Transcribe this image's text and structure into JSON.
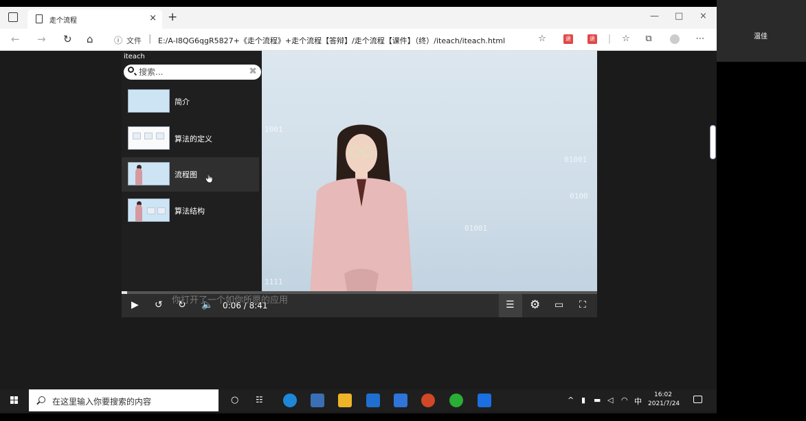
{
  "browser": {
    "tab_title": "走个流程",
    "tab_close": "×",
    "new_tab": "+",
    "window_controls": [
      "—",
      "□",
      "×"
    ],
    "url_label": "文件",
    "url": "E:/A-I8QG6qgR5827+《走个流程》+走个流程【答辩】/走个流程【课件】（终）/iteach/iteach.html",
    "nav_icons": [
      "back-icon",
      "forward-icon",
      "refresh-icon",
      "home-icon"
    ],
    "toolbar_badge": "退"
  },
  "player": {
    "brand": "iteach",
    "search_placeholder": "搜索...",
    "chapters": [
      {
        "label": "简介",
        "active": false
      },
      {
        "label": "算法的定义",
        "active": false
      },
      {
        "label": "流程图",
        "active": true
      },
      {
        "label": "算法结构",
        "active": false
      }
    ],
    "video_digits": [
      "1001",
      "01001",
      "0100",
      "01001",
      "1111"
    ],
    "subtitle": "你打开了一个如你所愿的应用",
    "time": "0:06 / 8:41",
    "progress": 0.012
  },
  "right_panel": {
    "name": "温佳"
  },
  "taskbar": {
    "search_placeholder": "在这里输入你要搜索的内容",
    "ime": "中",
    "clock_time": "16:02",
    "clock_date": "2021/7/24"
  },
  "colors": {
    "video_bg": "#cfdde8",
    "control_bar": "#2d2d2d",
    "badge_red": "#e04848"
  }
}
